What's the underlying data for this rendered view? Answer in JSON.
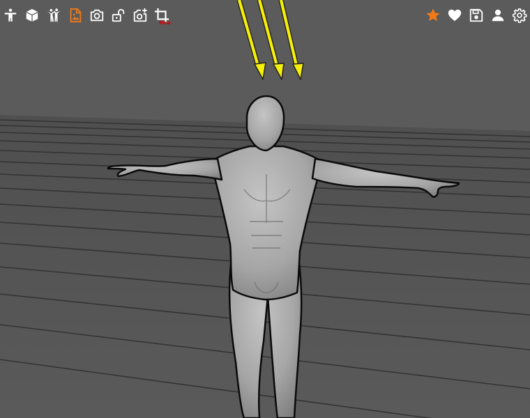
{
  "toolbar_left": {
    "items": [
      {
        "name": "pose-figure-icon",
        "color": "#ffffff"
      },
      {
        "name": "cube-icon",
        "color": "#ffffff"
      },
      {
        "name": "multi-figure-icon",
        "color": "#ffffff"
      },
      {
        "name": "image-document-icon",
        "color": "#f07a18",
        "active": true
      },
      {
        "name": "camera-icon",
        "color": "#ffffff"
      },
      {
        "name": "unlock-icon",
        "color": "#ffffff"
      },
      {
        "name": "add-camera-icon",
        "color": "#ffffff"
      },
      {
        "name": "crop-icon",
        "color": "#ffffff",
        "badge": "New"
      }
    ]
  },
  "toolbar_right": {
    "items": [
      {
        "name": "star-icon",
        "color": "#f07a18"
      },
      {
        "name": "heart-icon",
        "color": "#ffffff"
      },
      {
        "name": "save-icon",
        "color": "#ffffff"
      },
      {
        "name": "user-icon",
        "color": "#ffffff"
      },
      {
        "name": "settings-gear-icon",
        "color": "#ffffff"
      }
    ]
  },
  "scene": {
    "background_color": "#5b5b5b",
    "floor_color": "#535353",
    "grid_line_color": "#333333",
    "mannequin_color": "#a9a9a9",
    "light_arrow_color": "#f5ef0a",
    "light_arrows": 3
  }
}
